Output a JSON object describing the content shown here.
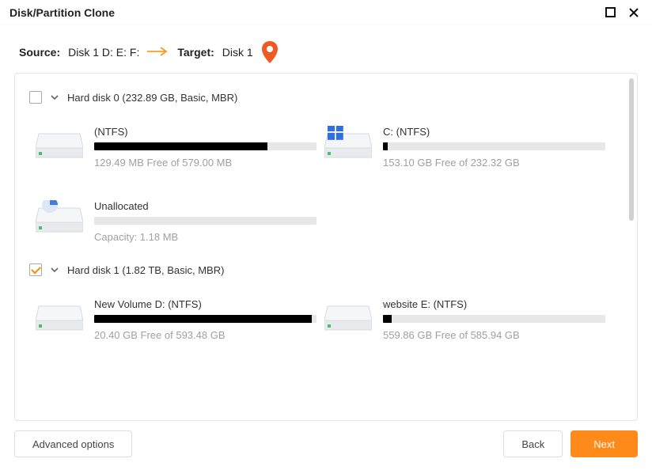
{
  "window": {
    "title": "Disk/Partition Clone"
  },
  "breadcrumb": {
    "source_label": "Source:",
    "source_value": "Disk 1 D: E: F:",
    "target_label": "Target:",
    "target_value": "Disk 1"
  },
  "disks": [
    {
      "checked": false,
      "label": "Hard disk 0 (232.89 GB, Basic, MBR)",
      "partitions": [
        {
          "icon": "drive",
          "title": "(NTFS)",
          "fill_pct": 78,
          "sub": "129.49 MB Free of 579.00 MB"
        },
        {
          "icon": "windows-drive",
          "title": "C: (NTFS)",
          "fill_pct": 2,
          "sub": "153.10 GB Free of 232.32 GB"
        },
        {
          "icon": "pie-drive",
          "title": "Unallocated",
          "fill_pct": 0,
          "sub": "Capacity: 1.18 MB"
        }
      ]
    },
    {
      "checked": true,
      "label": "Hard disk 1 (1.82 TB, Basic, MBR)",
      "partitions": [
        {
          "icon": "drive",
          "title": "New Volume D: (NTFS)",
          "fill_pct": 98,
          "sub": "20.40 GB Free of 593.48 GB"
        },
        {
          "icon": "drive",
          "title": "website E: (NTFS)",
          "fill_pct": 4,
          "sub": "559.86 GB Free of 585.94 GB"
        }
      ]
    }
  ],
  "footer": {
    "advanced": "Advanced options",
    "back": "Back",
    "next": "Next"
  }
}
